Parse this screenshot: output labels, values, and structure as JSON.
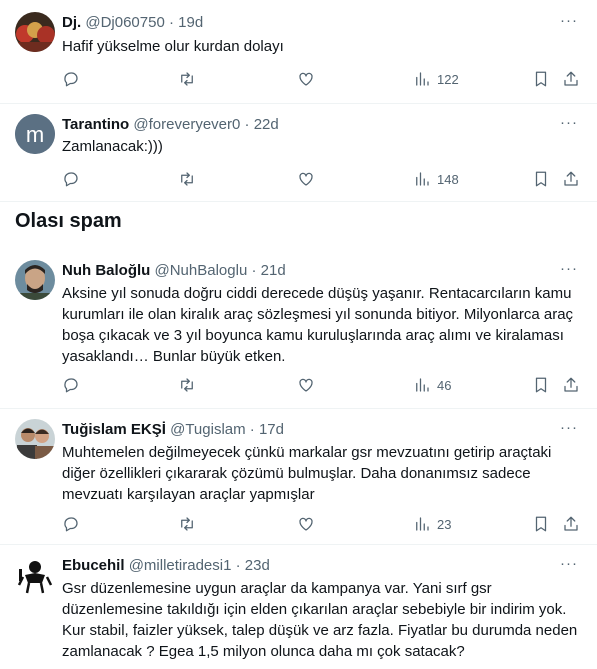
{
  "section_title": "Olası spam",
  "tweets": [
    {
      "name": "Dj.",
      "handle": "@Dj060750",
      "time": "19d",
      "text": "Hafif yükselme olur kurdan dolayı",
      "views": "122",
      "avatar": "avatar-photo"
    },
    {
      "name": "Tarantino",
      "handle": "@foreveryever0",
      "time": "22d",
      "text": "Zamlanacak:)))",
      "views": "148",
      "avatar_letter": "m",
      "avatar_color": "#5b7083"
    },
    {
      "name": "Nuh Baloğlu",
      "handle": "@NuhBaloglu",
      "time": "21d",
      "text": "Aksine yıl sonuda doğru ciddi derecede düşüş yaşanır. Rentacarcıların kamu kurumları ile olan kiralık araç sözleşmesi yıl sonunda bitiyor. Milyonlarca araç boşa çıkacak ve 3 yıl boyunca kamu kuruluşlarında araç alımı ve kiralaması yasaklandı… Bunlar büyük etken.",
      "views": "46",
      "avatar": "avatar-photo"
    },
    {
      "name": "Tuğislam EKŞİ",
      "handle": "@Tugislam",
      "time": "17d",
      "text": "Muhtemelen değilmeyecek çünkü markalar gsr mevzuatını getirip araçtaki diğer özellikleri çıkararak çözümü bulmuşlar. Daha donanımsız sadece mevzuatı karşılayan araçlar yapmışlar",
      "views": "23",
      "avatar": "avatar-photo"
    },
    {
      "name": "Ebucehil",
      "handle": "@milletiradesi1",
      "time": "23d",
      "text": "Gsr düzenlemesine uygun araçlar da kampanya var. Yani sırf gsr düzenlemesine takıldığı için elden çıkarılan araçlar sebebiyle bir indirim yok. Kur stabil, faizler yüksek, talep düşük ve arz fazla. Fiyatlar bu durumda neden zamlanacak ? Egea 1,5 milyon olunca daha mı çok satacak?",
      "views": "",
      "avatar": "avatar-illustration"
    }
  ],
  "separator": "·",
  "more_glyph": "···",
  "colors": {
    "text": "#0f1419",
    "secondary": "#536471",
    "border": "#eff3f4"
  },
  "icons": [
    "reply-icon",
    "retweet-icon",
    "like-icon",
    "views-icon",
    "bookmark-icon",
    "share-icon",
    "more-icon"
  ]
}
